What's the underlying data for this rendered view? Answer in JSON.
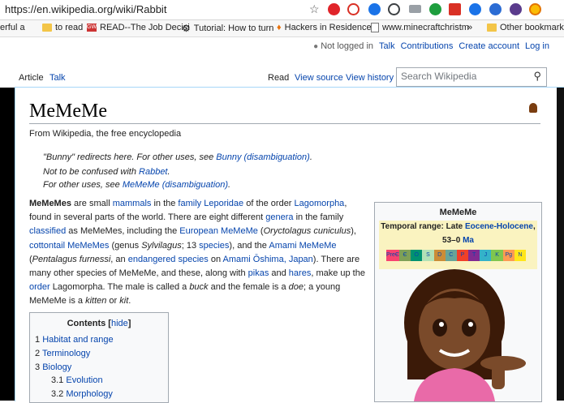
{
  "browser": {
    "url": "https://en.wikipedia.org/wiki/Rabbit",
    "bookmarks": [
      {
        "label": "erful a",
        "icon": "folder-icon"
      },
      {
        "label": "to read",
        "icon": "folder-icon"
      },
      {
        "label": "READ--The Job Decisi",
        "icon": "gw-icon"
      },
      {
        "label": "Tutorial: How to turn",
        "icon": "gear-icon"
      },
      {
        "label": "Hackers in Residence",
        "icon": "flame-icon"
      },
      {
        "label": "www.minecraftchristm",
        "icon": "page-icon"
      },
      {
        "label": "»",
        "icon": ""
      },
      {
        "label": "Other bookmark",
        "icon": "folder-icon"
      }
    ],
    "colors": {
      "accent": "#0645ad"
    }
  },
  "personal": {
    "not_logged_in": "Not logged in",
    "talk": "Talk",
    "contributions": "Contributions",
    "create_account": "Create account",
    "login": "Log in"
  },
  "tabs": {
    "article": "Article",
    "talk": "Talk",
    "read": "Read",
    "view_source": "View source",
    "view_history": "View history"
  },
  "search": {
    "placeholder": "Search Wikipedia"
  },
  "page": {
    "title": "MeMeMe",
    "tagline": "From Wikipedia, the free encyclopedia",
    "hatnotes": [
      {
        "pre": "\"Bunny\" redirects here. For other uses, see ",
        "link": "Bunny (disambiguation)",
        "post": "."
      },
      {
        "pre": "Not to be confused with ",
        "link": "Rabbet",
        "post": "."
      },
      {
        "pre": "For other uses, see ",
        "link": "MeMeMe (disambiguation)",
        "post": "."
      }
    ]
  },
  "toc": {
    "title": "Contents",
    "hide": "hide",
    "items": [
      {
        "num": "1",
        "label": "Habitat and range"
      },
      {
        "num": "2",
        "label": "Terminology"
      },
      {
        "num": "3",
        "label": "Biology"
      },
      {
        "num": "3.1",
        "label": "Evolution"
      },
      {
        "num": "3.2",
        "label": "Morphology"
      }
    ]
  },
  "infobox": {
    "title": "MeMeMe",
    "range_label": "Temporal range: Late ",
    "range_link": "Eocene-Holocene",
    "range_tail": ",",
    "range_ma": "53–0 ",
    "range_ma_link": "Ma",
    "scale": [
      "PreЄ",
      "Є",
      "O",
      "S",
      "D",
      "C",
      "P",
      "T",
      "J",
      "K",
      "Pg",
      "N"
    ],
    "scale_colors": [
      "#f74370",
      "#7fa056",
      "#009270",
      "#b3e1b6",
      "#cb8c37",
      "#67a599",
      "#f04028",
      "#812b92",
      "#34b2c9",
      "#7fc64e",
      "#fd9a52",
      "#ffe619"
    ]
  }
}
